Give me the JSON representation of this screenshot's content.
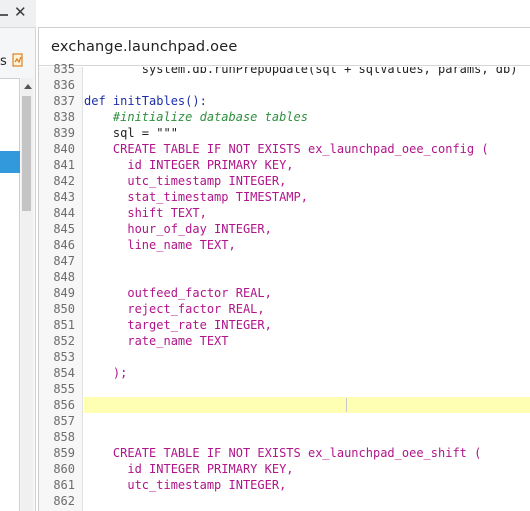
{
  "left_panel": {
    "label": "s",
    "close_glyph": "✕"
  },
  "editor": {
    "tab_title": "exchange.launchpad.oee",
    "lines": [
      {
        "num": "835",
        "text": "        system.db.runPrepUpdate(sql + sqlValues, params, db)",
        "style": "partial"
      },
      {
        "num": "836",
        "text": "",
        "style": "plain"
      },
      {
        "num": "837",
        "text": "def initTables():",
        "style": "kw"
      },
      {
        "num": "838",
        "text": "    #initialize database tables",
        "style": "comment"
      },
      {
        "num": "839",
        "text": "    sql = \"\"\"",
        "style": "plain"
      },
      {
        "num": "840",
        "text": "    CREATE TABLE IF NOT EXISTS ex_launchpad_oee_config (",
        "style": "str"
      },
      {
        "num": "841",
        "text": "      id INTEGER PRIMARY KEY,",
        "style": "str"
      },
      {
        "num": "842",
        "text": "      utc_timestamp INTEGER,",
        "style": "str"
      },
      {
        "num": "843",
        "text": "      stat_timestamp TIMESTAMP,",
        "style": "str"
      },
      {
        "num": "844",
        "text": "      shift TEXT,",
        "style": "str"
      },
      {
        "num": "845",
        "text": "      hour_of_day INTEGER,",
        "style": "str"
      },
      {
        "num": "846",
        "text": "      line_name TEXT,",
        "style": "str"
      },
      {
        "num": "847",
        "text": "",
        "style": "plain"
      },
      {
        "num": "848",
        "text": "",
        "style": "plain"
      },
      {
        "num": "849",
        "text": "      outfeed_factor REAL,",
        "style": "str"
      },
      {
        "num": "850",
        "text": "      reject_factor REAL,",
        "style": "str"
      },
      {
        "num": "851",
        "text": "      target_rate INTEGER,",
        "style": "str"
      },
      {
        "num": "852",
        "text": "      rate_name TEXT",
        "style": "str"
      },
      {
        "num": "853",
        "text": "",
        "style": "plain"
      },
      {
        "num": "854",
        "text": "    );",
        "style": "str"
      },
      {
        "num": "855",
        "text": "",
        "style": "plain"
      },
      {
        "num": "856",
        "text": "",
        "style": "highlight"
      },
      {
        "num": "857",
        "text": "",
        "style": "plain"
      },
      {
        "num": "858",
        "text": "",
        "style": "plain"
      },
      {
        "num": "859",
        "text": "    CREATE TABLE IF NOT EXISTS ex_launchpad_oee_shift (",
        "style": "str"
      },
      {
        "num": "860",
        "text": "      id INTEGER PRIMARY KEY,",
        "style": "str"
      },
      {
        "num": "861",
        "text": "      utc_timestamp INTEGER,",
        "style": "str"
      },
      {
        "num": "862",
        "text": "",
        "style": "plain"
      }
    ]
  }
}
